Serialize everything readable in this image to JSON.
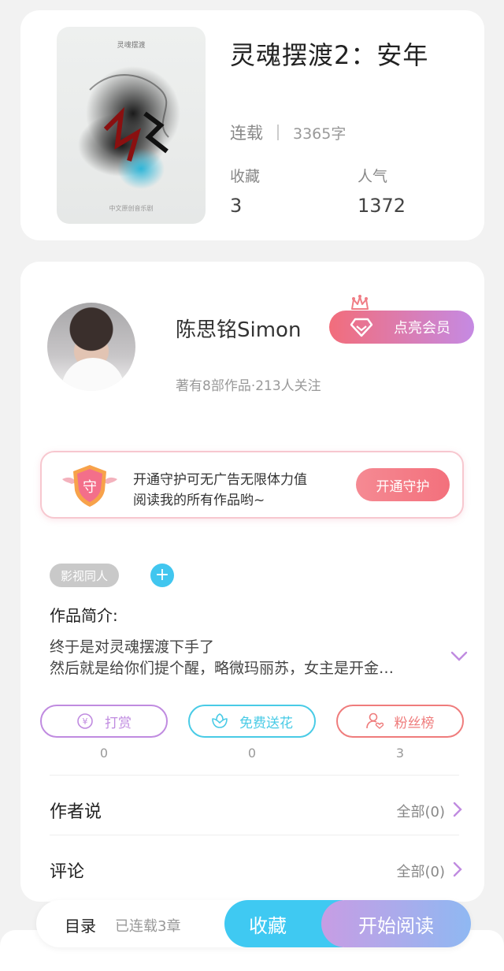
{
  "book": {
    "title": "灵魂摆渡2：安年",
    "status": "连载",
    "word_count": "3365字",
    "cover": {
      "top_text": "灵魂摆渡",
      "foot_text": "中文原创音乐剧"
    },
    "stats": [
      {
        "label": "收藏",
        "value": "3"
      },
      {
        "label": "人气",
        "value": "1372"
      }
    ]
  },
  "author": {
    "name": "陈思铭Simon",
    "meta": "著有8部作品·213人关注",
    "vip_label": "点亮会员"
  },
  "guard": {
    "badge": "守",
    "line1": "开通守护可无广告无限体力值",
    "line2": "阅读我的所有作品哟~",
    "button": "开通守护"
  },
  "tags": {
    "items": [
      "影视同人"
    ],
    "add": "+"
  },
  "intro": {
    "title": "作品简介:",
    "line1": "终于是对灵魂摆渡下手了",
    "line2": "然后就是给你们提个醒，略微玛丽苏，女主是开金…"
  },
  "actions": [
    {
      "label": "打赏",
      "count": "0",
      "color": "#c08be0"
    },
    {
      "label": "免费送花",
      "count": "0",
      "color": "#49cbe6"
    },
    {
      "label": "粉丝榜",
      "count": "3",
      "color": "#ef7c7c"
    }
  ],
  "sections": [
    {
      "title": "作者说",
      "link": "全部(0)"
    },
    {
      "title": "评论",
      "link": "全部(0)"
    }
  ],
  "bottom": {
    "toc": "目录",
    "chapters": "已连载3章",
    "favorite": "收藏",
    "read": "开始阅读"
  }
}
